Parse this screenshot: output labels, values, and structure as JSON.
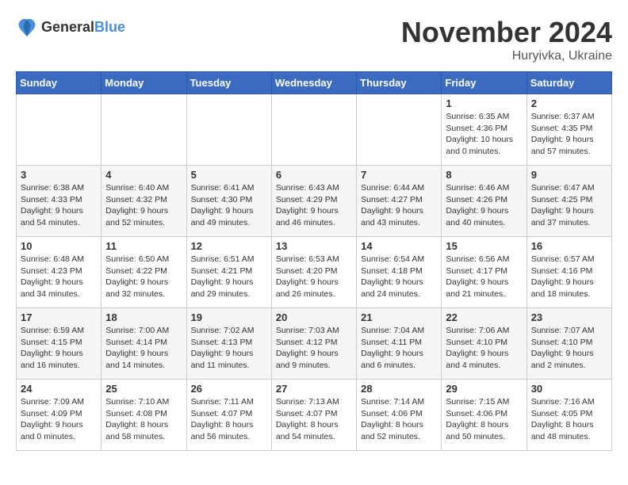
{
  "logo": {
    "general": "General",
    "blue": "Blue"
  },
  "title": {
    "month": "November 2024",
    "location": "Huryivka, Ukraine"
  },
  "headers": [
    "Sunday",
    "Monday",
    "Tuesday",
    "Wednesday",
    "Thursday",
    "Friday",
    "Saturday"
  ],
  "weeks": [
    [
      {
        "day": "",
        "info": ""
      },
      {
        "day": "",
        "info": ""
      },
      {
        "day": "",
        "info": ""
      },
      {
        "day": "",
        "info": ""
      },
      {
        "day": "",
        "info": ""
      },
      {
        "day": "1",
        "info": "Sunrise: 6:35 AM\nSunset: 4:36 PM\nDaylight: 10 hours\nand 0 minutes."
      },
      {
        "day": "2",
        "info": "Sunrise: 6:37 AM\nSunset: 4:35 PM\nDaylight: 9 hours\nand 57 minutes."
      }
    ],
    [
      {
        "day": "3",
        "info": "Sunrise: 6:38 AM\nSunset: 4:33 PM\nDaylight: 9 hours\nand 54 minutes."
      },
      {
        "day": "4",
        "info": "Sunrise: 6:40 AM\nSunset: 4:32 PM\nDaylight: 9 hours\nand 52 minutes."
      },
      {
        "day": "5",
        "info": "Sunrise: 6:41 AM\nSunset: 4:30 PM\nDaylight: 9 hours\nand 49 minutes."
      },
      {
        "day": "6",
        "info": "Sunrise: 6:43 AM\nSunset: 4:29 PM\nDaylight: 9 hours\nand 46 minutes."
      },
      {
        "day": "7",
        "info": "Sunrise: 6:44 AM\nSunset: 4:27 PM\nDaylight: 9 hours\nand 43 minutes."
      },
      {
        "day": "8",
        "info": "Sunrise: 6:46 AM\nSunset: 4:26 PM\nDaylight: 9 hours\nand 40 minutes."
      },
      {
        "day": "9",
        "info": "Sunrise: 6:47 AM\nSunset: 4:25 PM\nDaylight: 9 hours\nand 37 minutes."
      }
    ],
    [
      {
        "day": "10",
        "info": "Sunrise: 6:48 AM\nSunset: 4:23 PM\nDaylight: 9 hours\nand 34 minutes."
      },
      {
        "day": "11",
        "info": "Sunrise: 6:50 AM\nSunset: 4:22 PM\nDaylight: 9 hours\nand 32 minutes."
      },
      {
        "day": "12",
        "info": "Sunrise: 6:51 AM\nSunset: 4:21 PM\nDaylight: 9 hours\nand 29 minutes."
      },
      {
        "day": "13",
        "info": "Sunrise: 6:53 AM\nSunset: 4:20 PM\nDaylight: 9 hours\nand 26 minutes."
      },
      {
        "day": "14",
        "info": "Sunrise: 6:54 AM\nSunset: 4:18 PM\nDaylight: 9 hours\nand 24 minutes."
      },
      {
        "day": "15",
        "info": "Sunrise: 6:56 AM\nSunset: 4:17 PM\nDaylight: 9 hours\nand 21 minutes."
      },
      {
        "day": "16",
        "info": "Sunrise: 6:57 AM\nSunset: 4:16 PM\nDaylight: 9 hours\nand 18 minutes."
      }
    ],
    [
      {
        "day": "17",
        "info": "Sunrise: 6:59 AM\nSunset: 4:15 PM\nDaylight: 9 hours\nand 16 minutes."
      },
      {
        "day": "18",
        "info": "Sunrise: 7:00 AM\nSunset: 4:14 PM\nDaylight: 9 hours\nand 14 minutes."
      },
      {
        "day": "19",
        "info": "Sunrise: 7:02 AM\nSunset: 4:13 PM\nDaylight: 9 hours\nand 11 minutes."
      },
      {
        "day": "20",
        "info": "Sunrise: 7:03 AM\nSunset: 4:12 PM\nDaylight: 9 hours\nand 9 minutes."
      },
      {
        "day": "21",
        "info": "Sunrise: 7:04 AM\nSunset: 4:11 PM\nDaylight: 9 hours\nand 6 minutes."
      },
      {
        "day": "22",
        "info": "Sunrise: 7:06 AM\nSunset: 4:10 PM\nDaylight: 9 hours\nand 4 minutes."
      },
      {
        "day": "23",
        "info": "Sunrise: 7:07 AM\nSunset: 4:10 PM\nDaylight: 9 hours\nand 2 minutes."
      }
    ],
    [
      {
        "day": "24",
        "info": "Sunrise: 7:09 AM\nSunset: 4:09 PM\nDaylight: 9 hours\nand 0 minutes."
      },
      {
        "day": "25",
        "info": "Sunrise: 7:10 AM\nSunset: 4:08 PM\nDaylight: 8 hours\nand 58 minutes."
      },
      {
        "day": "26",
        "info": "Sunrise: 7:11 AM\nSunset: 4:07 PM\nDaylight: 8 hours\nand 56 minutes."
      },
      {
        "day": "27",
        "info": "Sunrise: 7:13 AM\nSunset: 4:07 PM\nDaylight: 8 hours\nand 54 minutes."
      },
      {
        "day": "28",
        "info": "Sunrise: 7:14 AM\nSunset: 4:06 PM\nDaylight: 8 hours\nand 52 minutes."
      },
      {
        "day": "29",
        "info": "Sunrise: 7:15 AM\nSunset: 4:06 PM\nDaylight: 8 hours\nand 50 minutes."
      },
      {
        "day": "30",
        "info": "Sunrise: 7:16 AM\nSunset: 4:05 PM\nDaylight: 8 hours\nand 48 minutes."
      }
    ]
  ]
}
